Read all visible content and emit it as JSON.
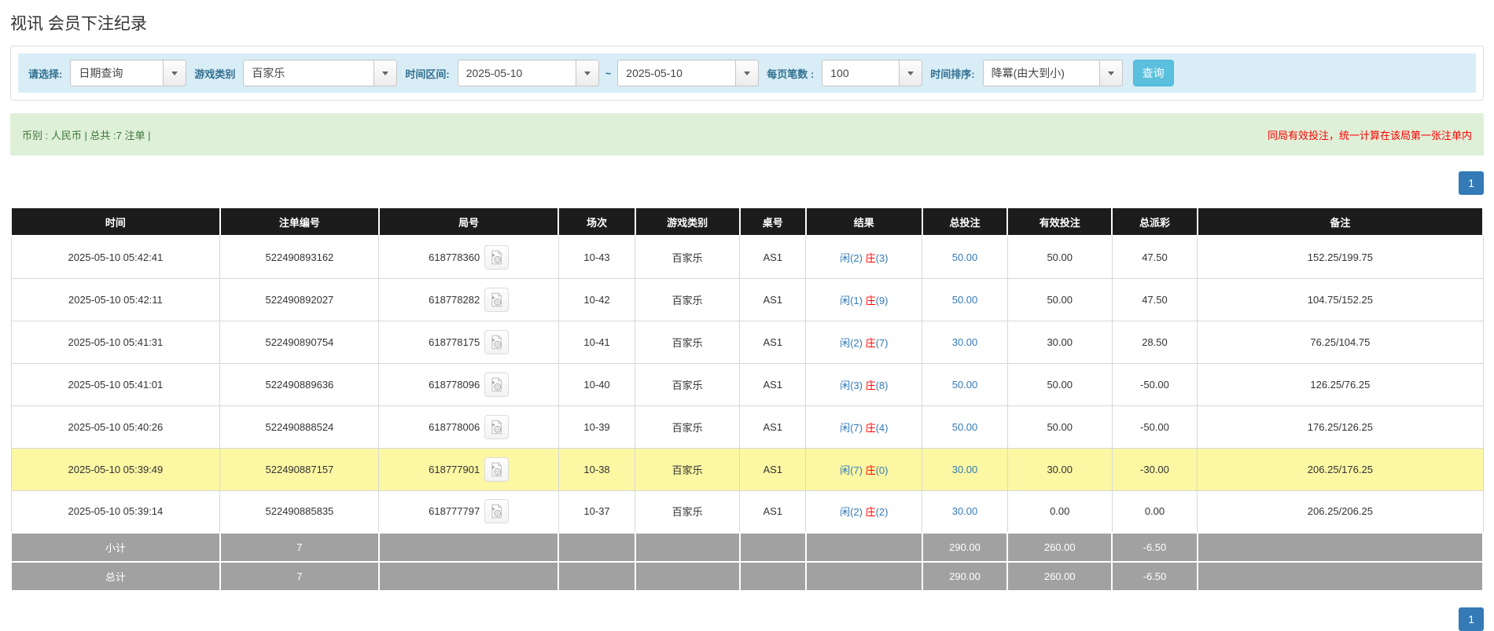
{
  "page": {
    "title": "视讯 会员下注纪录"
  },
  "colors": {
    "accent_blue": "#337ab7",
    "info_bar_bg": "#d9edf7",
    "search_button_bg": "#5bc0de",
    "summary_bg": "#dff0d8",
    "summary_text": "#3c763d",
    "warning_red": "#ff0000",
    "header_bg": "#1c1c1c",
    "highlight_row_bg": "#fbf7a3",
    "footer_row_bg": "#a1a1a1"
  },
  "icons": {
    "combo_caret": "caret-down-icon",
    "round_video": "video-file-icon"
  },
  "filters": {
    "query_type": {
      "label": "请选择:",
      "value": "日期查询"
    },
    "game_type": {
      "label": "游戏类别",
      "value": "百家乐"
    },
    "time_range": {
      "label": "时间区间:",
      "from": "2025-05-10",
      "separator": "~",
      "to": "2025-05-10"
    },
    "page_size": {
      "label": "每页笔数 :",
      "value": "100"
    },
    "time_sort": {
      "label": "时间排序:",
      "value": "降冪(由大到小)"
    },
    "search_label": "查询"
  },
  "summary_bar": {
    "left": "币别 : 人民币 | 总共 :7 注单 |",
    "right": "同局有效投注，统一计算在该局第一张注单内"
  },
  "pagination": {
    "page_label": "1"
  },
  "table": {
    "headers": [
      "时间",
      "注单编号",
      "局号",
      "场次",
      "游戏类别",
      "桌号",
      "结果",
      "总投注",
      "有效投注",
      "总派彩",
      "备注"
    ],
    "col_widths_pct": [
      14.2,
      10.8,
      12.2,
      5.2,
      7.1,
      4.5,
      7.9,
      5.8,
      7.1,
      5.8,
      19.4
    ],
    "rows": [
      {
        "time": "2025-05-10 05:42:41",
        "bet_id": "522490893162",
        "round_id": "618778360",
        "session": "10-43",
        "game": "百家乐",
        "table_id": "AS1",
        "result": {
          "player": "闲(2)",
          "banker_label": "庄",
          "banker_value": "(3)"
        },
        "total_bet": "50.00",
        "valid_bet": "50.00",
        "payout": "47.50",
        "note": "152.25/199.75",
        "highlight": false
      },
      {
        "time": "2025-05-10 05:42:11",
        "bet_id": "522490892027",
        "round_id": "618778282",
        "session": "10-42",
        "game": "百家乐",
        "table_id": "AS1",
        "result": {
          "player": "闲(1)",
          "banker_label": "庄",
          "banker_value": "(9)"
        },
        "total_bet": "50.00",
        "valid_bet": "50.00",
        "payout": "47.50",
        "note": "104.75/152.25",
        "highlight": false
      },
      {
        "time": "2025-05-10 05:41:31",
        "bet_id": "522490890754",
        "round_id": "618778175",
        "session": "10-41",
        "game": "百家乐",
        "table_id": "AS1",
        "result": {
          "player": "闲(2)",
          "banker_label": "庄",
          "banker_value": "(7)"
        },
        "total_bet": "30.00",
        "valid_bet": "30.00",
        "payout": "28.50",
        "note": "76.25/104.75",
        "highlight": false
      },
      {
        "time": "2025-05-10 05:41:01",
        "bet_id": "522490889636",
        "round_id": "618778096",
        "session": "10-40",
        "game": "百家乐",
        "table_id": "AS1",
        "result": {
          "player": "闲(3)",
          "banker_label": "庄",
          "banker_value": "(8)"
        },
        "total_bet": "50.00",
        "valid_bet": "50.00",
        "payout": "-50.00",
        "note": "126.25/76.25",
        "highlight": false
      },
      {
        "time": "2025-05-10 05:40:26",
        "bet_id": "522490888524",
        "round_id": "618778006",
        "session": "10-39",
        "game": "百家乐",
        "table_id": "AS1",
        "result": {
          "player": "闲(7)",
          "banker_label": "庄",
          "banker_value": "(4)"
        },
        "total_bet": "50.00",
        "valid_bet": "50.00",
        "payout": "-50.00",
        "note": "176.25/126.25",
        "highlight": false
      },
      {
        "time": "2025-05-10 05:39:49",
        "bet_id": "522490887157",
        "round_id": "618777901",
        "session": "10-38",
        "game": "百家乐",
        "table_id": "AS1",
        "result": {
          "player": "闲(7)",
          "banker_label": "庄",
          "banker_value": "(0)"
        },
        "total_bet": "30.00",
        "valid_bet": "30.00",
        "payout": "-30.00",
        "note": "206.25/176.25",
        "highlight": true
      },
      {
        "time": "2025-05-10 05:39:14",
        "bet_id": "522490885835",
        "round_id": "618777797",
        "session": "10-37",
        "game": "百家乐",
        "table_id": "AS1",
        "result": {
          "player": "闲(2)",
          "banker_label": "庄",
          "banker_value": "(2)"
        },
        "total_bet": "30.00",
        "valid_bet": "0.00",
        "payout": "0.00",
        "note": "206.25/206.25",
        "highlight": false
      }
    ],
    "footer": [
      {
        "label": "小计",
        "count": "7",
        "total_bet": "290.00",
        "valid_bet": "260.00",
        "payout": "-6.50"
      },
      {
        "label": "总计",
        "count": "7",
        "total_bet": "290.00",
        "valid_bet": "260.00",
        "payout": "-6.50"
      }
    ]
  }
}
